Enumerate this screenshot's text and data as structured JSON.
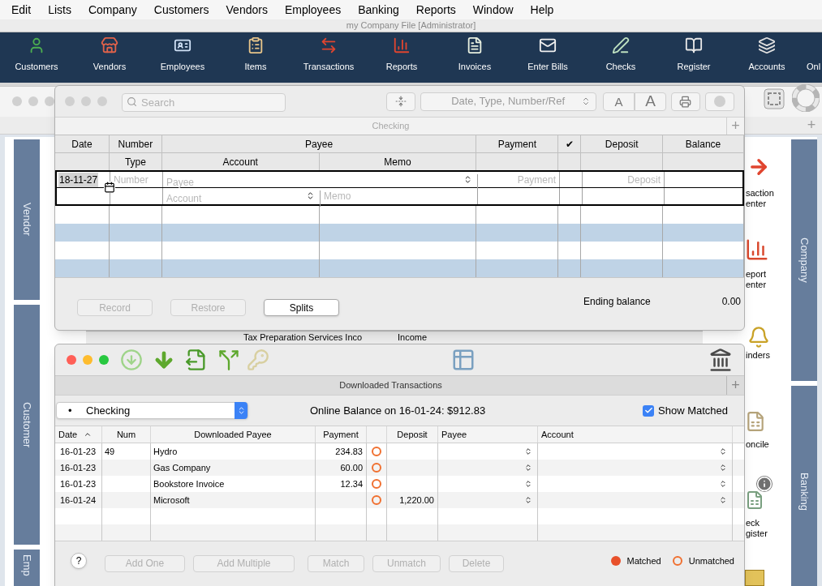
{
  "menu": [
    "Edit",
    "Lists",
    "Company",
    "Customers",
    "Vendors",
    "Employees",
    "Banking",
    "Reports",
    "Window",
    "Help"
  ],
  "app_title": "my Company File [Administrator]",
  "toolbar": [
    "Customers",
    "Vendors",
    "Employees",
    "Items",
    "Transactions",
    "Reports",
    "Invoices",
    "Enter Bills",
    "Checks",
    "Register",
    "Accounts",
    "Onl"
  ],
  "home": {
    "add": "+",
    "left_tabs": [
      "Vendor",
      "Customer",
      "Emp"
    ],
    "right_tabs": [
      "Company",
      "Banking"
    ],
    "shortcuts": [
      {
        "lines": [
          "saction",
          "enter"
        ]
      },
      {
        "lines": [
          "eport",
          "enter"
        ]
      },
      {
        "lines": [
          "inders"
        ]
      },
      {
        "lines": [
          "oncile"
        ]
      },
      {
        "lines": [
          "eck",
          "gister"
        ]
      }
    ],
    "peek_row": [
      "Tax Preparation Services Inco",
      "Income"
    ]
  },
  "register": {
    "search": {
      "placeholder": "Search"
    },
    "sort": "Date, Type, Number/Ref",
    "font_buttons": [
      "A",
      "A"
    ],
    "subtitle": "Checking",
    "add": "+",
    "header_top": [
      "Date",
      "Number",
      "Payee",
      "Payment",
      "✔",
      "Deposit",
      "Balance"
    ],
    "header_bottom": [
      "Type",
      "Account",
      "Memo"
    ],
    "entry": {
      "date": "18-11-27",
      "number_placeholder": "Number",
      "payee_placeholder": "Payee",
      "payment_placeholder": "Payment",
      "deposit_placeholder": "Deposit",
      "account_placeholder": "Account",
      "memo_placeholder": "Memo"
    },
    "buttons": [
      {
        "label": "Record",
        "disabled": true
      },
      {
        "label": "Restore",
        "disabled": true
      },
      {
        "label": "Splits",
        "disabled": false
      }
    ],
    "ending_label": "Ending balance",
    "ending_value": "0.00"
  },
  "downloads": {
    "title": "Downloaded Transactions",
    "add": "+",
    "account": {
      "bullet": "•",
      "value": "Checking"
    },
    "online_balance": "Online Balance on 16-01-24: $912.83",
    "show_matched": {
      "label": "Show Matched",
      "checked": true
    },
    "columns": [
      {
        "label": "Date",
        "sorted": true
      },
      {
        "label": "Num",
        "sorted": false
      },
      {
        "label": "Downloaded Payee",
        "sorted": false
      },
      {
        "label": "Payment",
        "sorted": false
      },
      {
        "label": "Deposit",
        "sorted": false
      },
      {
        "label": "Payee",
        "sorted": false
      },
      {
        "label": "Account",
        "sorted": false
      }
    ],
    "rows": [
      {
        "date": "16-01-23",
        "num": "49",
        "payee": "Hydro",
        "payment": "234.83",
        "matched": false,
        "deposit": ""
      },
      {
        "date": "16-01-23",
        "num": "",
        "payee": "Gas Company",
        "payment": "60.00",
        "matched": false,
        "deposit": ""
      },
      {
        "date": "16-01-23",
        "num": "",
        "payee": "Bookstore Invoice",
        "payment": "12.34",
        "matched": false,
        "deposit": ""
      },
      {
        "date": "16-01-24",
        "num": "",
        "payee": "Microsoft",
        "payment": "",
        "matched": false,
        "deposit": "1,220.00"
      }
    ],
    "help": "?",
    "buttons": [
      {
        "label": "Add One",
        "disabled": true
      },
      {
        "label": "Add Multiple",
        "disabled": true
      },
      {
        "label": "Match",
        "disabled": true
      },
      {
        "label": "Unmatch",
        "disabled": true
      },
      {
        "label": "Delete",
        "disabled": true
      }
    ],
    "legend": [
      {
        "label": "Matched",
        "matched": true
      },
      {
        "label": "Unmatched",
        "matched": false
      }
    ]
  }
}
